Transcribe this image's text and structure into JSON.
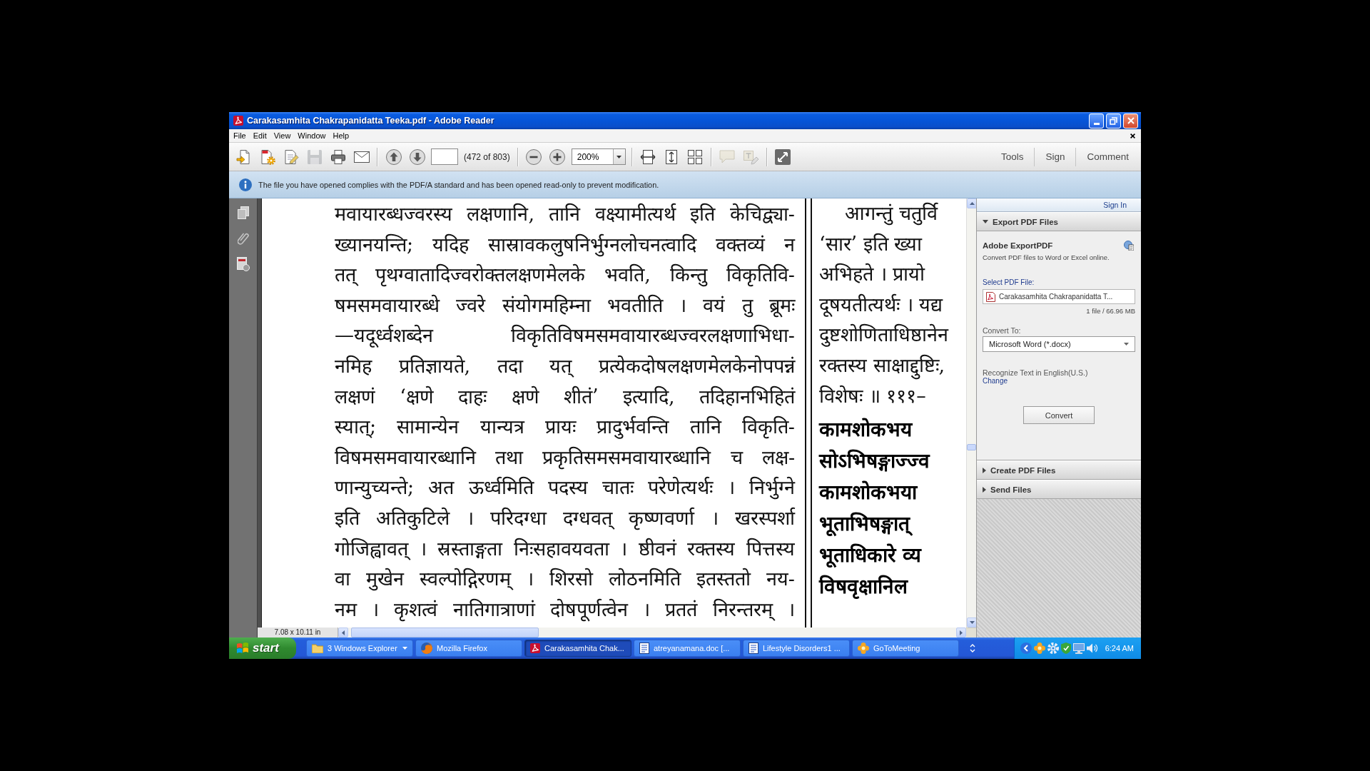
{
  "window": {
    "title": "Carakasamhita Chakrapanidatta Teeka.pdf - Adobe Reader"
  },
  "menu": [
    "File",
    "Edit",
    "View",
    "Window",
    "Help"
  ],
  "toolbar": {
    "file_buttons": [
      {
        "disabled": false
      },
      {
        "disabled": false
      },
      {
        "disabled": false
      },
      {
        "disabled": true
      },
      {
        "disabled": false
      },
      {
        "disabled": false
      }
    ],
    "page_count": "(472 of 803)",
    "zoom": "200%",
    "comment_buttons": [
      {
        "disabled": true
      },
      {
        "disabled": true
      }
    ],
    "panes": [
      "Tools",
      "Sign",
      "Comment"
    ]
  },
  "info_bar": {
    "message": "The file you have opened complies with the PDF/A standard and has been opened read-only to prevent modification."
  },
  "document": {
    "left_page": [
      "मवायारब्धज्वरस्य लक्षणानि, तानि वक्ष्यामीत्यर्थ इति केचिद्व्या-",
      "ख्यानयन्ति; यदिह सास्रावकलुषनिर्भुग्नलोचनत्वादि वक्तव्यं न",
      "तत् पृथग्वातादिज्वरोक्तलक्षणमेलके भवति, किन्तु विकृतिवि-",
      "षमसमवायारब्धे ज्वरे संयोगमहिम्ना भवतीति । वयं तु ब्रूमः",
      "—यदूर्ध्वशब्देन विकृतिविषमसमवायारब्धज्वरलक्षणाभिधा-",
      "नमिह प्रतिज्ञायते, तदा यत् प्रत्येकदोषलक्षणमेलकेनोपपन्नं",
      "लक्षणं ‘क्षणे दाहः क्षणे शीतं’ इत्यादि, तदिहानभिहितं",
      "स्यात्; सामान्येन यान्यत्र प्रायः प्रादुर्भवन्ति तानि विकृति-",
      "विषमसमवायारब्धानि तथा प्रकृतिसमसमवायारब्धानि च लक्ष-",
      "णान्युच्यन्ते; अत ऊर्ध्वमिति पदस्य चातः परेणेत्यर्थः । निर्भुग्ने",
      "इति अतिकुटिले । परिदग्धा दग्धवत् कृष्णवर्णा । खरस्पर्शा",
      "गोजिह्वावत् । स्रस्ताङ्गता निःसहावयवता । ष्ठीवनं रक्तस्य पित्तस्य",
      "वा मुखेन स्वल्पोद्गिरणम् । शिरसो लोठनमिति इतस्ततो नय-",
      "नम । कृशत्वं नातिगात्राणां दोषपूर्णत्वेन । प्रततं निरन्तरम् ।"
    ],
    "right_page": [
      {
        "kind": "commentary_start",
        "text": "आगन्तुं चतुर्वि"
      },
      {
        "kind": "commentary",
        "text": "‘सार’ इति ख्या"
      },
      {
        "kind": "commentary",
        "text": "अभिहते । प्रायो"
      },
      {
        "kind": "commentary",
        "text": "दूषयतीत्यर्थः । यद्य"
      },
      {
        "kind": "commentary",
        "text": "दुष्टशोणिताधिष्ठानेन"
      },
      {
        "kind": "commentary",
        "text": "रक्तस्य साक्षाद्दुष्टिः,"
      },
      {
        "kind": "commentary",
        "text": "विशेषः ॥ १११–"
      },
      {
        "kind": "verse",
        "text": "कामशोकभय"
      },
      {
        "kind": "verse",
        "text": "सोऽभिषङ्गाज्ज्व"
      },
      {
        "kind": "verse",
        "text": "कामशोकभया"
      },
      {
        "kind": "verse",
        "text": "भूताभिषङ्गात्"
      },
      {
        "kind": "verse",
        "text": "भूताधिकारे व्य"
      },
      {
        "kind": "verse",
        "text": "विषवृक्षानिल"
      }
    ]
  },
  "status_bar": {
    "page_size": "7.08 x 10.11 in"
  },
  "side_panel": {
    "sign_in": "Sign In",
    "sections": [
      {
        "title": "Export PDF Files",
        "expanded": true,
        "heading": "Adobe ExportPDF",
        "description": "Convert PDF files to Word or Excel online.",
        "file_label": "Select PDF File:",
        "file": "Carakasamhita Chakrapanidatta T...",
        "file_info": "1 file / 66.96 MB",
        "convert_label": "Convert To:",
        "format": "Microsoft Word (*.docx)",
        "ocr_text": "Recognize Text in English(U.S.)",
        "ocr_link": "Change",
        "button": "Convert"
      },
      {
        "title": "Create PDF Files",
        "expanded": false
      },
      {
        "title": "Send Files",
        "expanded": false
      }
    ]
  },
  "taskbar": {
    "start": "start",
    "tasks": [
      {
        "kind": "explorer",
        "label": "3 Windows Explorer",
        "grouped": true,
        "selected": false
      },
      {
        "kind": "browser",
        "label": "Mozilla Firefox",
        "grouped": false,
        "selected": false
      },
      {
        "kind": "reader",
        "label": "Carakasamhita Chak...",
        "grouped": false,
        "selected": true
      },
      {
        "kind": "document",
        "label": "atreyanamana.doc [...",
        "grouped": false,
        "selected": false
      },
      {
        "kind": "document",
        "label": "Lifestyle Disorders1 ...",
        "grouped": false,
        "selected": false
      },
      {
        "kind": "meeting",
        "label": "GoToMeeting",
        "grouped": false,
        "selected": false
      }
    ],
    "clock": "6:24 AM"
  }
}
